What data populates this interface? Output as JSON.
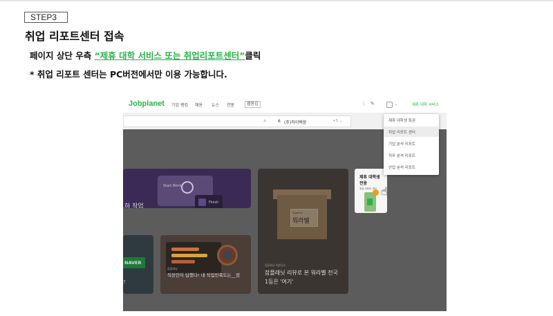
{
  "step_label": "STEP3",
  "title": "취업 리포트센터 접속",
  "instruction": {
    "prefix": "페이지 상단 우측 ",
    "q1": "“",
    "highlight": "제휴 대학 서비스 또는 취업리포트센터",
    "q2": "”",
    "suffix": "클릭"
  },
  "note": "* 취업 리포트 센터는 PC버전에서만 이용 가능합니다.",
  "colors": {
    "brand": "#2bb24c"
  },
  "screenshot": {
    "logo": "Jobplanet",
    "menu": [
      "기업 랭킹",
      "채용",
      "뉴스",
      "연봉",
      "웹봉김"
    ],
    "icons": [
      "bell-icon",
      "pen-icon",
      "user-icon",
      "chevron-down-icon"
    ],
    "partner_link": "제휴 대학 서비스",
    "search": {
      "value": "(주)하이택함",
      "prefix": "6",
      "suffix": "+5 ⌄"
    },
    "dropdown": [
      "제휴 대학생 특권",
      "취업 리포트 센터",
      "기업 분석 리포트",
      "직무 분석 리포트",
      "산업 분석 리포트"
    ],
    "cards": {
      "c1_title": "하 작업",
      "c1_start": "Start Work",
      "c1_finish": "Finish",
      "c2_badge": "NAVER",
      "c2_q": "?",
      "c3_tag": "잡플래닛",
      "c3_title": "직장인이 답했다! 내 직업만족도는__점",
      "c4_tag": "잡플래닛 워칭업소",
      "c4_title": "잡플래닛 리뷰로 본 워라벨 전국 1등은 '여기'",
      "c4_word": "워라벨",
      "c4_small": "Together",
      "c5_title": "제휴 대학생 전용",
      "c5_sub": "취업 리포트 센터"
    }
  }
}
